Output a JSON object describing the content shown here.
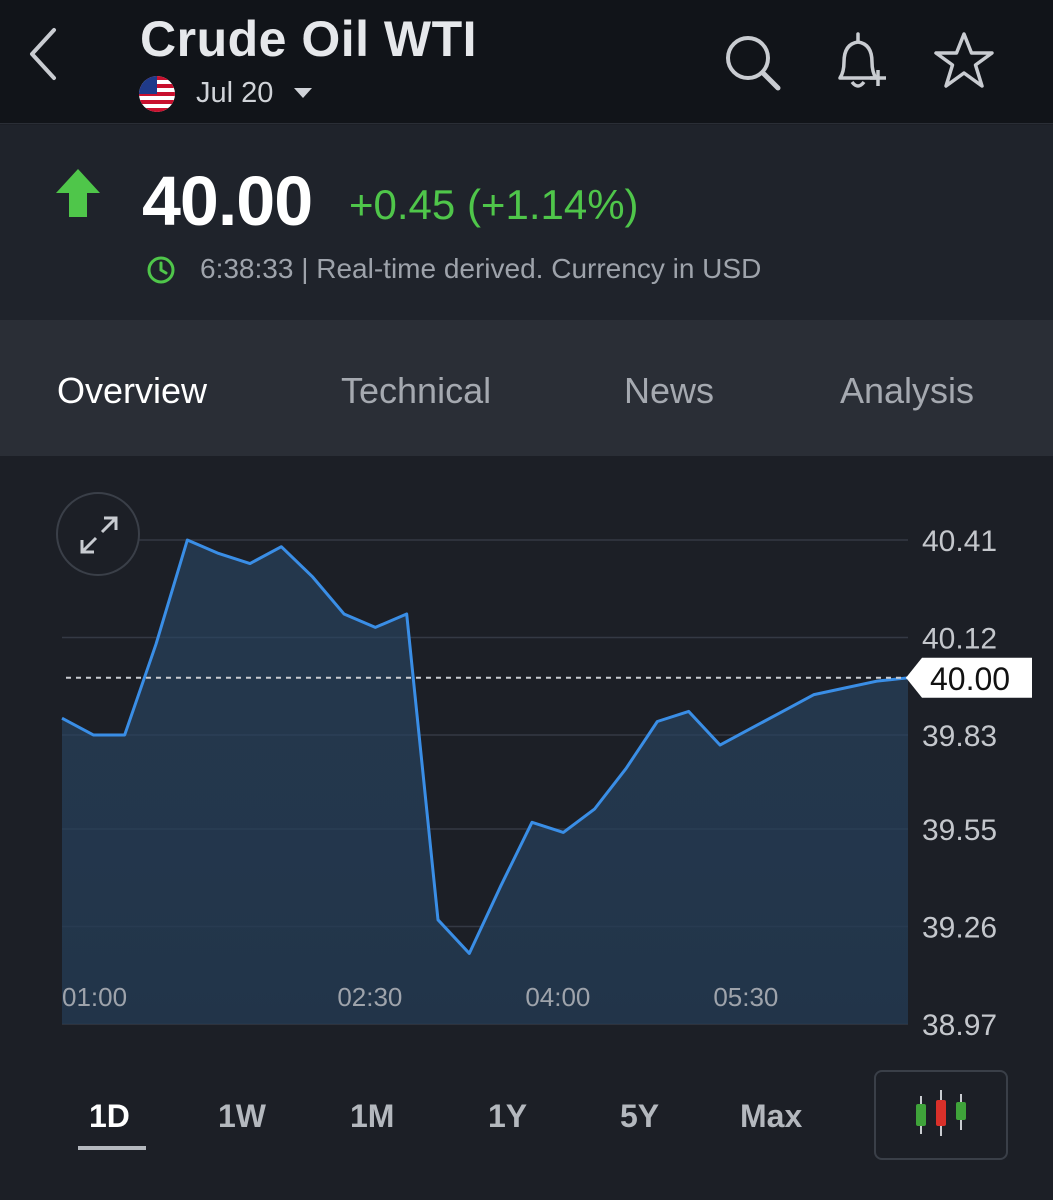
{
  "header": {
    "title": "Crude Oil WTI",
    "contract": "Jul 20",
    "icons": [
      "back-chevron-icon",
      "search-icon",
      "bell-plus-icon",
      "star-icon"
    ]
  },
  "quote": {
    "price": "40.00",
    "change": "+0.45 (+1.14%)",
    "time": "6:38:33",
    "meta": "6:38:33 | Real-time derived. Currency in USD",
    "up_color": "#4fc64a"
  },
  "tabs": [
    "Overview",
    "Technical",
    "News",
    "Analysis"
  ],
  "active_tab": "Overview",
  "ranges": [
    "1D",
    "1W",
    "1M",
    "1Y",
    "5Y",
    "Max"
  ],
  "active_range": "1D",
  "chart_data": {
    "type": "area",
    "x_ticks": [
      "01:00",
      "02:30",
      "04:00",
      "05:30"
    ],
    "y_ticks": [
      "40.41",
      "40.12",
      "39.83",
      "39.55",
      "39.26",
      "38.97"
    ],
    "ylim": [
      38.97,
      40.41
    ],
    "current_price_label": "40.00",
    "current_price": 40.0,
    "line_color": "#3a8ee6",
    "x": [
      "00:00",
      "00:15",
      "00:30",
      "00:45",
      "01:00",
      "01:15",
      "01:30",
      "01:45",
      "02:00",
      "02:15",
      "02:30",
      "02:45",
      "03:00",
      "03:15",
      "03:30",
      "03:45",
      "04:00",
      "04:15",
      "04:30",
      "04:45",
      "05:00",
      "05:15",
      "05:30",
      "05:45",
      "06:00",
      "06:15",
      "06:30",
      "06:38"
    ],
    "values": [
      39.88,
      39.83,
      39.83,
      40.1,
      40.41,
      40.37,
      40.34,
      40.39,
      40.3,
      40.19,
      40.15,
      40.19,
      39.28,
      39.18,
      39.38,
      39.57,
      39.54,
      39.61,
      39.73,
      39.87,
      39.9,
      39.8,
      39.85,
      39.9,
      39.95,
      39.97,
      39.99,
      40.0
    ]
  }
}
